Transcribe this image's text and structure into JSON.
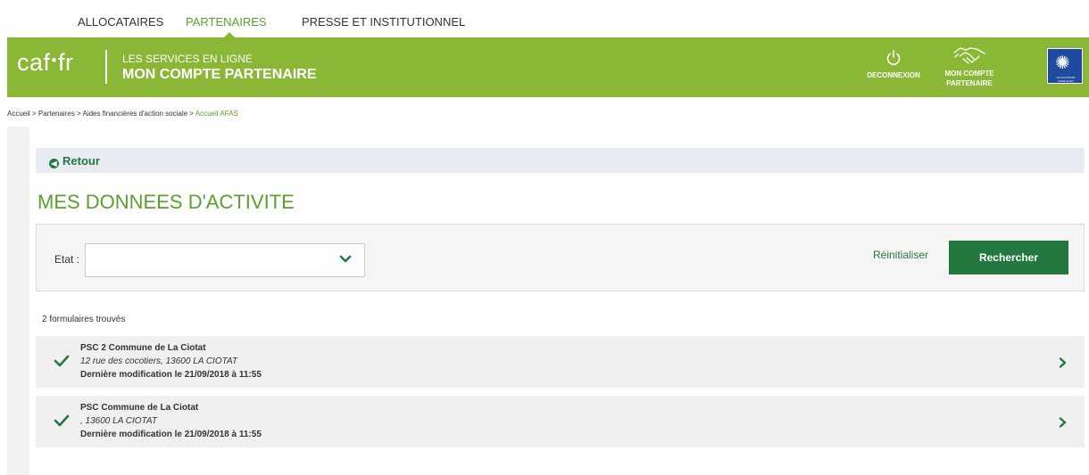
{
  "nav": {
    "items": [
      {
        "label": "ALLOCATAIRES"
      },
      {
        "label": "PARTENAIRES"
      },
      {
        "label": "PRESSE ET INSTITUTIONNEL"
      }
    ],
    "active_color": "#5aa02c"
  },
  "header": {
    "logo": {
      "left": "caf",
      "dot": "•",
      "right": "fr"
    },
    "subtitle_line1": "LES SERVICES EN LIGNE",
    "subtitle_line2": "MON COMPTE PARTENAIRE",
    "logout_label": "DECONNEXION",
    "logout_icon": "power-icon",
    "account_label_line1": "MON COMPTE",
    "account_label_line2": "PARTENAIRE",
    "account_icon": "handshake-icon",
    "flag_text": "ALLOCATIONS FAMILIALES",
    "banner_color": "#8ab735"
  },
  "breadcrumb": {
    "path": "Accueil > Partenaires > Aides financières d'action sociale > ",
    "current": "Accueil AFAS"
  },
  "back": {
    "label": "Retour",
    "icon": "arrow-left-circle-icon"
  },
  "page_title": "MES DONNEES D'ACTIVITE",
  "filter": {
    "etat_label": "Etat :",
    "etat_value": "",
    "reset_label": "Réinitialiser",
    "search_label": "Rechercher",
    "button_color": "#237840"
  },
  "results": {
    "count_text": "2 formulaires trouvés",
    "items": [
      {
        "title": "PSC 2 Commune de La Ciotat",
        "address": "12 rue des cocotiers, 13600 LA CIOTAT",
        "modified": "Dernière modification le 21/09/2018 à 11:55"
      },
      {
        "title": "PSC Commune de La Ciotat",
        "address": ", 13600 LA CIOTAT",
        "modified": "Dernière modification le 21/09/2018 à 11:55"
      }
    ]
  }
}
